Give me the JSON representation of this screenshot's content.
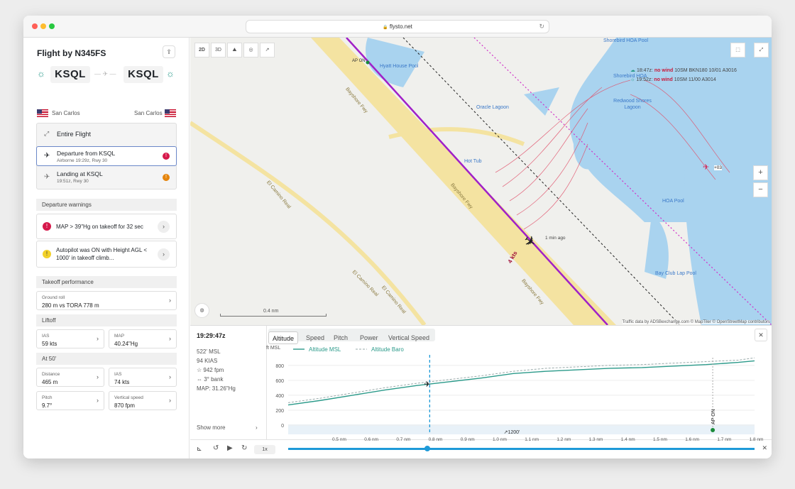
{
  "browser": {
    "url": "flysto.net"
  },
  "flight": {
    "title": "Flight by N345FS",
    "from": "KSQL",
    "to": "KSQL",
    "from_city": "San Carlos",
    "to_city": "San Carlos"
  },
  "phases": [
    {
      "title": "Entire Flight",
      "sub": ""
    },
    {
      "title": "Departure from KSQL",
      "sub": "Airborne 19:29z, Rwy 30"
    },
    {
      "title": "Landing at KSQL",
      "sub": "19:51z, Rwy 30"
    }
  ],
  "warnings": {
    "header": "Departure warnings",
    "items": [
      "MAP > 39\"Hg on takeoff for 32 sec",
      "Autopilot was ON with Height AGL < 1000' in takeoff climb..."
    ]
  },
  "takeoff": {
    "header": "Takeoff performance",
    "ground_roll_label": "Ground roll",
    "ground_roll_value": "280 m vs TORA 778 m"
  },
  "liftoff": {
    "header": "Liftoff",
    "ias_label": "IAS",
    "ias_value": "59 kts",
    "map_label": "MAP",
    "map_value": "40.24\"Hg"
  },
  "at50": {
    "header": "At 50'",
    "distance_label": "Distance",
    "distance_value": "465 m",
    "ias_label": "IAS",
    "ias_value": "74 kts",
    "pitch_label": "Pitch",
    "pitch_value": "9.7°",
    "vs_label": "Vertical speed",
    "vs_value": "870 fpm"
  },
  "map": {
    "view_buttons": [
      "2D",
      "3D"
    ],
    "labels": [
      "Shorebird HOA Pool",
      "Hyatt House Pool",
      "Oracle Lagoon",
      "Redwood Shores Lagoon",
      "Shorebird HOA",
      "HOA Pool",
      "Bay Club Lap Pool",
      "Bayshore Fwy",
      "Bayshore Fwy",
      "Bayshore Fwy",
      "El Camino Real",
      "El Camino Real",
      "El Camino Real",
      "Hot Tub"
    ],
    "wx": [
      {
        "time": "18:47z:",
        "wind": "no wind",
        "rest": "10SM BKN180 10/01 A3016"
      },
      {
        "time": "19:52z:",
        "wind": "no wind",
        "rest": "10SM 11/00 A3014"
      }
    ],
    "ap_on": "AP ON",
    "wind_tag": "4 kts",
    "time_ago": "1 min ago",
    "traffic_tag": "+03",
    "scale": "0.4 nm",
    "attribution": "Traffic data by ADSBexchange.com  © MapTiler © OpenStreetMap contributors"
  },
  "status": {
    "time": "19:29:47z",
    "msl": "522' MSL",
    "kias": "94 KIAS",
    "vs": "942 fpm",
    "bank": "3° bank",
    "map": "MAP: 31.26\"Hg",
    "show_more": "Show more"
  },
  "tabs": [
    "Altitude",
    "Speed",
    "Pitch",
    "Power",
    "Vertical Speed"
  ],
  "chart_data": {
    "type": "line",
    "ylabel": "ft MSL",
    "yticks": [
      0,
      200,
      400,
      600,
      800
    ],
    "ylim": [
      0,
      1000
    ],
    "series": [
      {
        "name": "Altitude MSL",
        "color": "#2b9a8a"
      },
      {
        "name": "Altitude Baro",
        "color": "#9aa"
      }
    ],
    "x_nm": [
      0.4,
      0.5,
      0.6,
      0.7,
      0.8,
      0.9,
      1.0,
      1.1,
      1.2,
      1.3,
      1.4,
      1.5,
      1.6,
      1.7,
      1.8,
      1.85
    ],
    "msl": [
      270,
      330,
      400,
      470,
      530,
      580,
      630,
      690,
      720,
      740,
      760,
      770,
      790,
      810,
      840,
      860
    ],
    "baro": [
      300,
      360,
      430,
      500,
      560,
      610,
      660,
      720,
      760,
      780,
      800,
      810,
      830,
      850,
      870,
      900
    ],
    "annotations": [
      "AP ON",
      "↗1200'"
    ]
  },
  "timeline": {
    "speed": "1x",
    "ticks": [
      "0.5 nm",
      "0.6 nm",
      "0.7 nm",
      "0.8 nm",
      "0.9 nm",
      "1.0 nm",
      "1.1 nm",
      "1.2 nm",
      "1.3 nm",
      "1.4 nm",
      "1.5 nm",
      "1.6 nm",
      "1.7 nm",
      "1.8 nm"
    ]
  }
}
